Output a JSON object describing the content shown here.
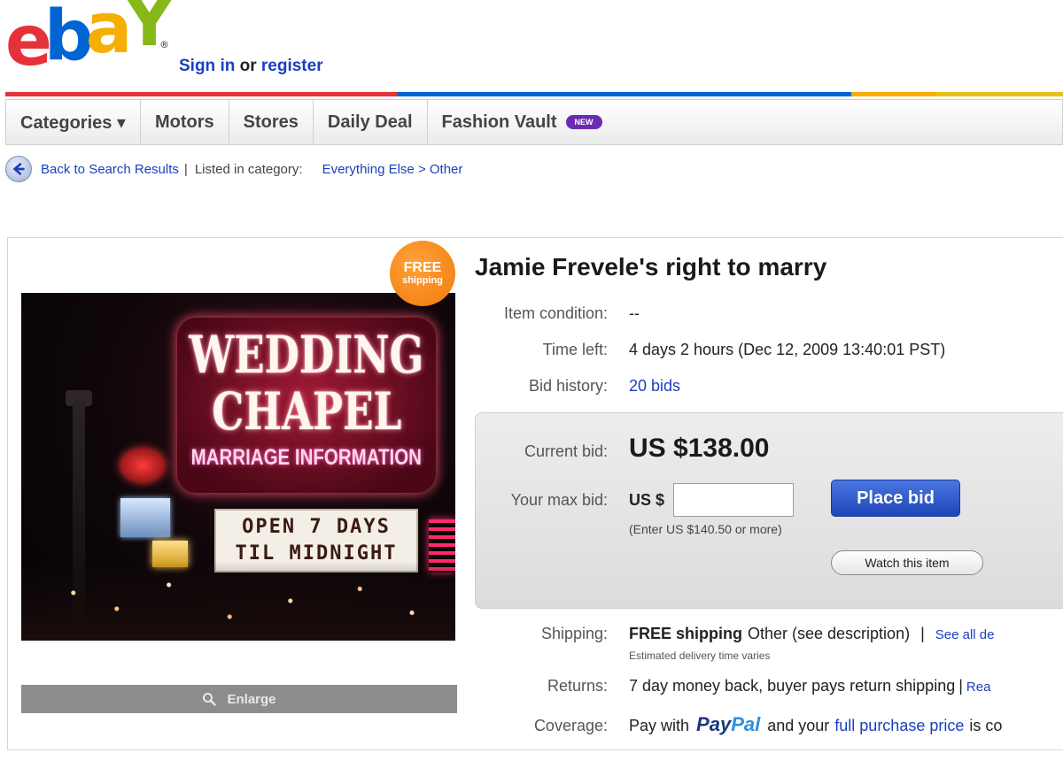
{
  "brand": {
    "logo_letters": [
      "e",
      "b",
      "a",
      "Y"
    ],
    "registered_mark": "®",
    "colors": {
      "e": "#e53238",
      "b": "#0064d2",
      "a": "#f5af02",
      "y": "#86b817"
    }
  },
  "header": {
    "sign_in": "Sign in",
    "or": "or",
    "register": "register"
  },
  "color_bar": [
    "#e53238",
    "#0064d2",
    "#f5af02",
    "#86b817"
  ],
  "nav": {
    "items": [
      "Categories ▾",
      "Motors",
      "Stores",
      "Daily Deal",
      "Fashion Vault"
    ],
    "new_badge": "NEW"
  },
  "breadcrumb": {
    "back": "Back to Search Results",
    "separator": "|",
    "listed_in": "Listed in category:",
    "category": "Everything Else > Other"
  },
  "photo": {
    "sign_lines": [
      "WEDDING",
      "CHAPEL"
    ],
    "sign_sub": "MARRIAGE INFORMATION",
    "marquee_lines": [
      "OPEN 7 DAYS",
      "TIL MIDNIGHT"
    ]
  },
  "free_shipping_badge": {
    "line1": "FREE",
    "line2": "shipping"
  },
  "enlarge_label": "Enlarge",
  "item": {
    "title": "Jamie Frevele's right to marry",
    "condition_label": "Item condition:",
    "condition_value": "--",
    "time_left_label": "Time left:",
    "time_left_value": "4 days 2 hours (Dec 12, 2009 13:40:01 PST)",
    "bid_history_label": "Bid history:",
    "bid_history_value": "20 bids"
  },
  "bidding": {
    "current_bid_label": "Current bid:",
    "current_bid_value": "US $138.00",
    "max_bid_label": "Your max bid:",
    "currency_prefix": "US $",
    "input_value": "",
    "place_bid": "Place bid",
    "hint": "(Enter US $140.50 or more)",
    "watch": "Watch this item"
  },
  "shipping": {
    "label": "Shipping:",
    "free": "FREE shipping",
    "method": "Other (see description)",
    "separator": "|",
    "see_all": "See all de",
    "estimate": "Estimated delivery time varies"
  },
  "returns": {
    "label": "Returns:",
    "value": "7 day money back, buyer pays return shipping",
    "separator": "|",
    "link": "Rea"
  },
  "coverage": {
    "label": "Coverage:",
    "pay_with": "Pay with",
    "paypal_1": "Pay",
    "paypal_2": "Pal",
    "and_your": "and your",
    "link": "full purchase price",
    "tail": "is co"
  }
}
